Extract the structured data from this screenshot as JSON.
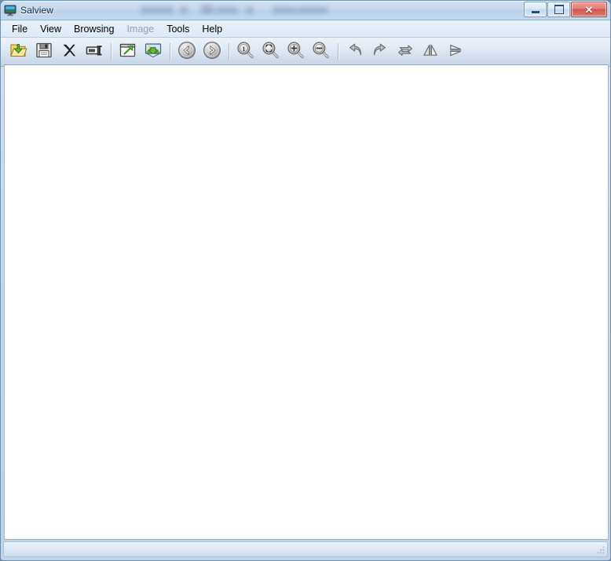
{
  "window": {
    "title": "Salview",
    "app_icon": "monitor-icon",
    "controls": {
      "minimize_label": "Minimize",
      "maximize_label": "Maximize",
      "close_label": "Close"
    }
  },
  "menu": {
    "items": [
      {
        "label": "File",
        "disabled": false
      },
      {
        "label": "View",
        "disabled": false
      },
      {
        "label": "Browsing",
        "disabled": false
      },
      {
        "label": "Image",
        "disabled": true
      },
      {
        "label": "Tools",
        "disabled": false
      },
      {
        "label": "Help",
        "disabled": false
      }
    ]
  },
  "toolbar": {
    "groups": [
      {
        "buttons": [
          {
            "icon": "open-folder-icon",
            "label": "Open"
          },
          {
            "icon": "save-floppy-icon",
            "label": "Save"
          },
          {
            "icon": "close-x-icon",
            "label": "Close"
          },
          {
            "icon": "rename-icon",
            "label": "Rename"
          }
        ]
      },
      {
        "buttons": [
          {
            "icon": "open-external-icon",
            "label": "Open With External Editor"
          },
          {
            "icon": "set-wallpaper-icon",
            "label": "Set As Wallpaper"
          }
        ]
      },
      {
        "buttons": [
          {
            "icon": "navigate-back-icon",
            "label": "Previous Image"
          },
          {
            "icon": "navigate-forward-icon",
            "label": "Next Image"
          }
        ]
      },
      {
        "buttons": [
          {
            "icon": "zoom-actual-size-icon",
            "label": "Actual Size"
          },
          {
            "icon": "zoom-fit-icon",
            "label": "Fit To Window"
          },
          {
            "icon": "zoom-in-icon",
            "label": "Zoom In"
          },
          {
            "icon": "zoom-out-icon",
            "label": "Zoom Out"
          }
        ]
      },
      {
        "buttons": [
          {
            "icon": "rotate-left-icon",
            "label": "Rotate Left"
          },
          {
            "icon": "rotate-right-icon",
            "label": "Rotate Right"
          },
          {
            "icon": "rotate-180-icon",
            "label": "Rotate 180"
          },
          {
            "icon": "flip-horizontal-icon",
            "label": "Flip Horizontal"
          },
          {
            "icon": "flip-vertical-icon",
            "label": "Flip Vertical"
          }
        ]
      }
    ]
  },
  "canvas": {
    "content": ""
  },
  "status_bar": {
    "text": ""
  },
  "colors": {
    "title_bar": "#c4d9ee",
    "toolbar": "#dbe6f2",
    "canvas": "#ffffff",
    "accent_green": "#5aa82e",
    "close_red": "#cf554b",
    "folder_yellow": "#f3cf5e"
  }
}
